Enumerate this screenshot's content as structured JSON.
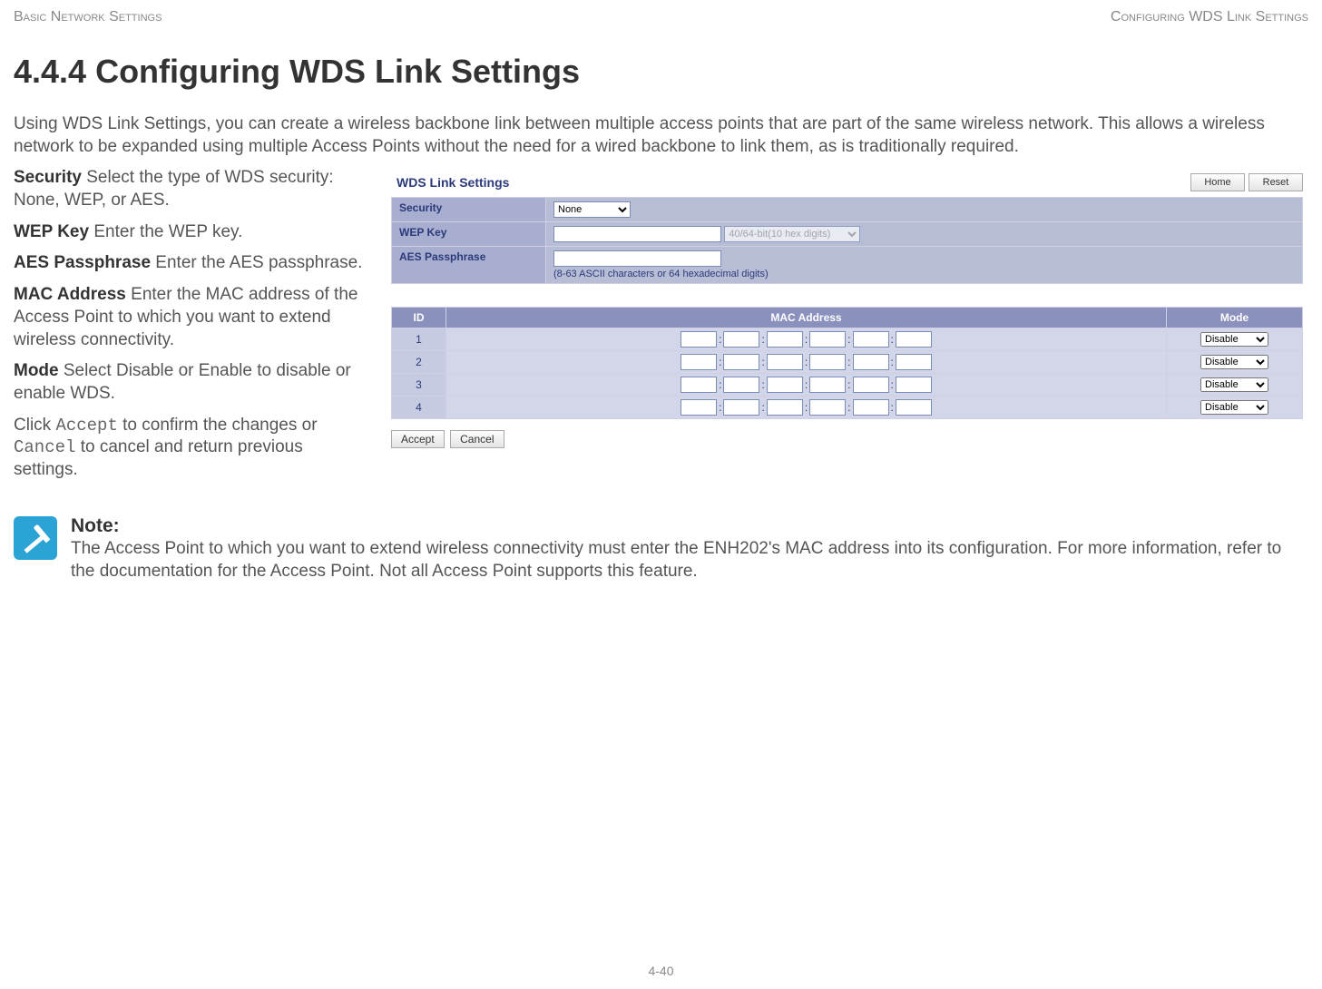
{
  "header": {
    "left": "Basic Network Settings",
    "right": "Configuring WDS Link Settings"
  },
  "title": "4.4.4 Configuring WDS Link Settings",
  "intro": "Using WDS Link Settings, you can create a wireless backbone link between multiple access points that are part of the same wireless network. This allows a wireless network to be expanded using multiple Access Points without the need for a wired backbone to link them, as is traditionally required.",
  "defs": {
    "security_label": "Security",
    "security_text": "  Select the type of WDS security: None, WEP, or AES.",
    "wep_label": "WEP Key",
    "wep_text": "  Enter the WEP key.",
    "aes_label": "AES Passphrase",
    "aes_text": "  Enter the AES passphrase.",
    "mac_label": "MAC Address",
    "mac_text": "  Enter the MAC address of the Access Point to which you want to extend wireless connectivity.",
    "mode_label": "Mode",
    "mode_text": "  Select Disable or Enable to disable or enable WDS.",
    "click_pre": "Click ",
    "accept": "Accept",
    "click_mid": " to confirm the changes or ",
    "cancel": "Cancel",
    "click_post": " to cancel and return previous settings."
  },
  "panel": {
    "title": "WDS Link Settings",
    "home": "Home",
    "reset": "Reset",
    "security_row_label": "Security",
    "security_value": "None",
    "wep_row_label": "WEP Key",
    "wep_bits": "40/64-bit(10 hex digits)",
    "aes_row_label": "AES Passphrase",
    "aes_hint": "(8-63 ASCII characters or 64 hexadecimal digits)",
    "mac_headers": {
      "id": "ID",
      "mac": "MAC Address",
      "mode": "Mode"
    },
    "rows": [
      {
        "id": "1",
        "mode": "Disable"
      },
      {
        "id": "2",
        "mode": "Disable"
      },
      {
        "id": "3",
        "mode": "Disable"
      },
      {
        "id": "4",
        "mode": "Disable"
      }
    ],
    "accept_btn": "Accept",
    "cancel_btn": "Cancel"
  },
  "note": {
    "label": "Note:",
    "text": "The Access Point to which you want to extend wireless connectivity must enter the ENH202's MAC address into its configuration. For more information, refer to the documentation for the Access Point. Not all Access Point supports this feature."
  },
  "page_number": "4-40"
}
